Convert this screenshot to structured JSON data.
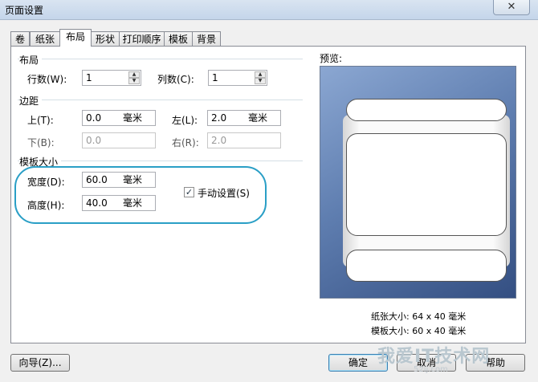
{
  "window": {
    "title": "页面设置",
    "close": "✕"
  },
  "tabs": [
    {
      "label": "卷"
    },
    {
      "label": "纸张"
    },
    {
      "label": "布局"
    },
    {
      "label": "形状"
    },
    {
      "label": "打印顺序"
    },
    {
      "label": "模板"
    },
    {
      "label": "背景"
    }
  ],
  "active_tab": "布局",
  "layout": {
    "group_label": "布局",
    "rows_label": "行数(W):",
    "rows_value": "1",
    "cols_label": "列数(C):",
    "cols_value": "1"
  },
  "margins": {
    "group_label": "边距",
    "top_label": "上(T):",
    "top_value": "0.0",
    "top_unit": "毫米",
    "left_label": "左(L):",
    "left_value": "2.0",
    "left_unit": "毫米",
    "bottom_label": "下(B):",
    "bottom_value": "0.0",
    "right_label": "右(R):",
    "right_value": "2.0"
  },
  "template_size": {
    "group_label": "模板大小",
    "width_label": "宽度(D):",
    "width_value": "60.0",
    "width_unit": "毫米",
    "height_label": "高度(H):",
    "height_value": "40.0",
    "height_unit": "毫米",
    "manual_label": "手动设置(S)",
    "manual_checked": true
  },
  "preview": {
    "label": "预览:",
    "paper_size": "纸张大小: 64 x 40 毫米",
    "template_size": "模板大小: 60 x 40 毫米"
  },
  "buttons": {
    "wizard": "向导(Z)...",
    "ok": "确定",
    "cancel": "取消",
    "help": "帮助"
  },
  "watermark": {
    "main": "我爱IT技术网",
    "sub": "52ij.com"
  },
  "colors": {
    "highlight": "#2a9fc6",
    "preview_bg": "#5f7eb0"
  }
}
